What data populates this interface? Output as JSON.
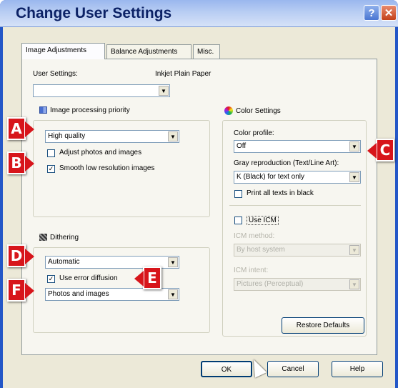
{
  "window": {
    "title": "Change User Settings",
    "help_glyph": "?",
    "close_glyph": "✕"
  },
  "tabs": [
    {
      "label": "Image Adjustments"
    },
    {
      "label": "Balance Adjustments"
    },
    {
      "label": "Misc."
    }
  ],
  "user_settings": {
    "label": "User Settings:",
    "value": "",
    "paper": "Inkjet Plain Paper"
  },
  "image_priority": {
    "title": "Image processing priority",
    "mode": "High quality",
    "adjust_photos": {
      "label": "Adjust photos and images",
      "checked": false
    },
    "smooth_low_res": {
      "label": "Smooth low resolution images",
      "checked": true
    }
  },
  "dithering": {
    "title": "Dithering",
    "mode": "Automatic",
    "error_diffusion": {
      "label": "Use error diffusion",
      "checked": true
    },
    "diffusion_target": "Photos and images"
  },
  "color_settings": {
    "title": "Color Settings",
    "profile_label": "Color profile:",
    "profile_value": "Off",
    "gray_label": "Gray reproduction (Text/Line Art):",
    "gray_value": "K (Black) for text only",
    "print_black": {
      "label": "Print all texts in black",
      "checked": false
    },
    "use_icm": {
      "label": "Use ICM",
      "checked": false
    },
    "icm_method_label": "ICM method:",
    "icm_method_value": "By host system",
    "icm_intent_label": "ICM intent:",
    "icm_intent_value": "Pictures (Perceptual)",
    "restore_label": "Restore Defaults"
  },
  "buttons": {
    "ok": "OK",
    "cancel": "Cancel",
    "help": "Help"
  },
  "callouts": [
    "A",
    "B",
    "C",
    "D",
    "E",
    "F"
  ],
  "glyphs": {
    "check": "✓",
    "arrow": "▼"
  },
  "colors": {
    "callout_red": "#d7151b",
    "title_blue": "#0c2266",
    "frame_blue": "#2457c7"
  }
}
